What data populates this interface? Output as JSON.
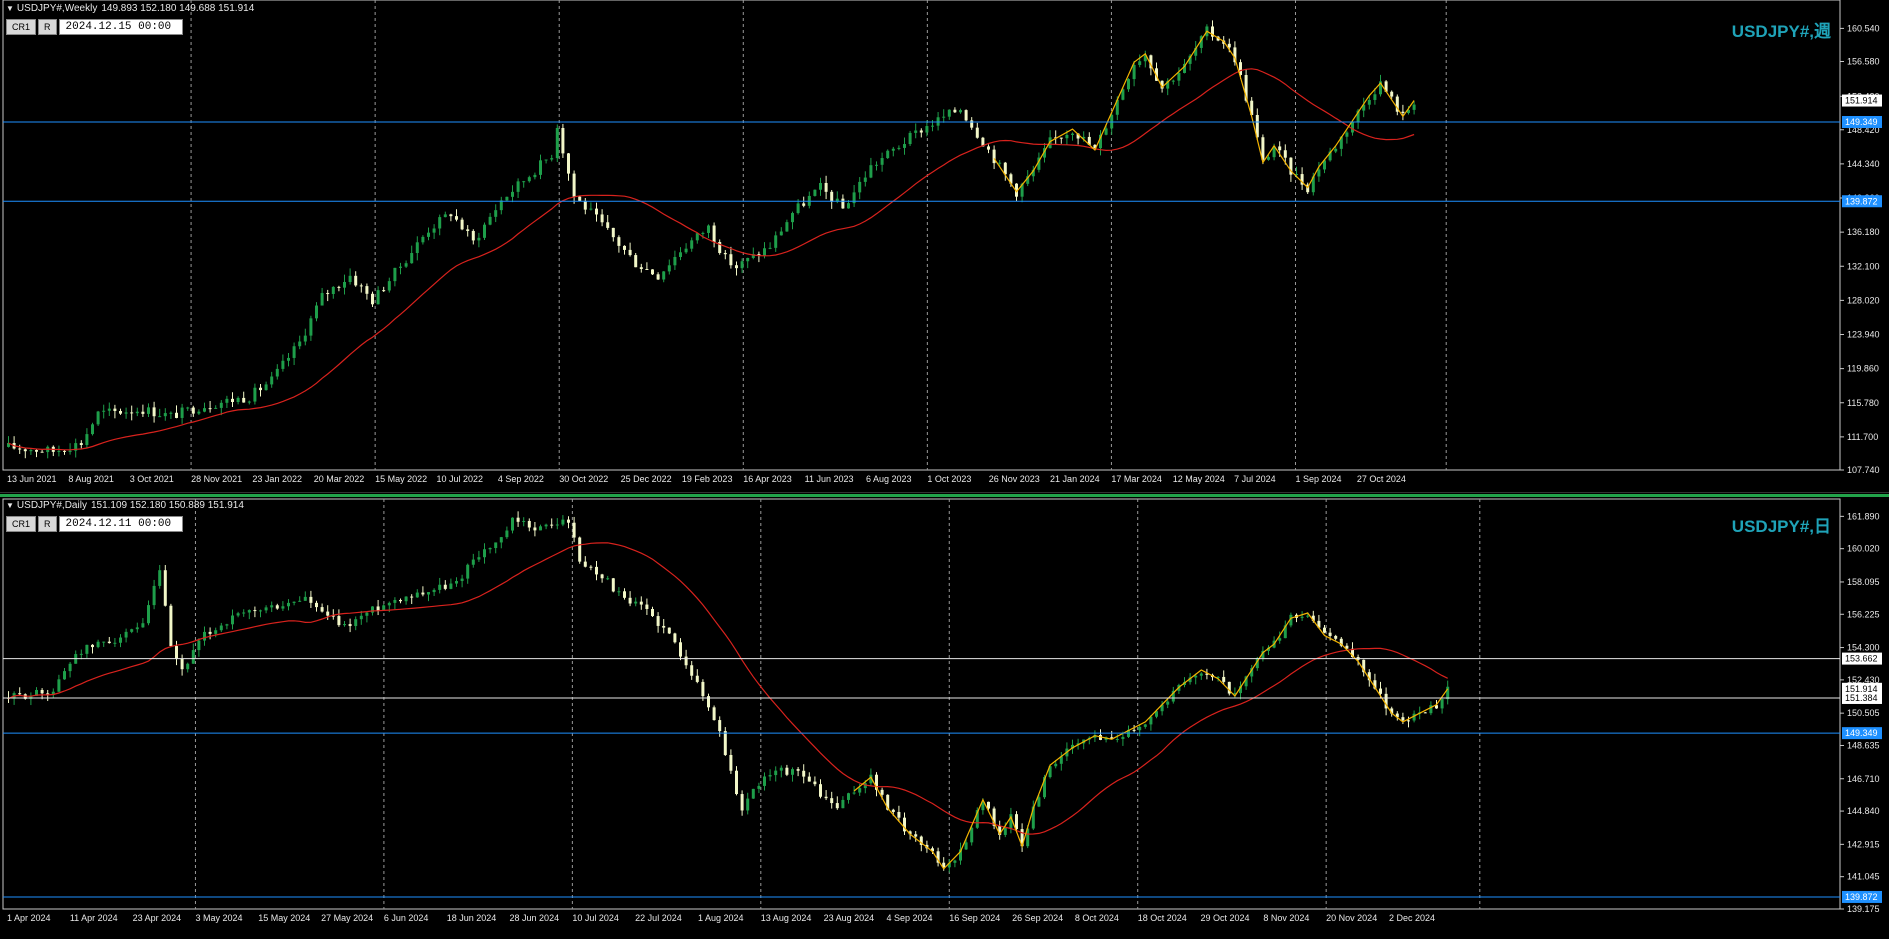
{
  "weekly": {
    "header_name": "USDJPY#,Weekly",
    "ohlc": "149.893 152.180 149.688 151.914",
    "cr_label": "CR1",
    "r_label": "R",
    "date_value": "2024.12.15 00:00",
    "symbol_label": "USDJPY#,週",
    "price_ticks": [
      "160.540",
      "156.580",
      "152.420",
      "148.420",
      "144.340",
      "140.260",
      "136.180",
      "132.100",
      "128.020",
      "123.940",
      "119.860",
      "115.780",
      "111.700",
      "107.740"
    ],
    "price_labels": [
      {
        "text": "151.914",
        "bg": "#ffffff",
        "fg": "#000000"
      },
      {
        "text": "149.349",
        "bg": "#1e90ff",
        "fg": "#ffffff"
      },
      {
        "text": "139.872",
        "bg": "#1e90ff",
        "fg": "#ffffff"
      }
    ],
    "time_labels": [
      "13 Jun 2021",
      "8 Aug 2021",
      "3 Oct 2021",
      "28 Nov 2021",
      "23 Jan 2022",
      "20 Mar 2022",
      "15 May 2022",
      "10 Jul 2022",
      "4 Sep 2022",
      "30 Oct 2022",
      "25 Dec 2022",
      "19 Feb 2023",
      "16 Apr 2023",
      "11 Jun 2023",
      "6 Aug 2023",
      "1 Oct 2023",
      "26 Nov 2023",
      "21 Jan 2024",
      "17 Mar 2024",
      "12 May 2024",
      "7 Jul 2024",
      "1 Sep 2024",
      "27 Oct 2024"
    ]
  },
  "daily": {
    "header_name": "USDJPY#,Daily",
    "ohlc": "151.109 152.180 150.889 151.914",
    "cr_label": "CR1",
    "r_label": "R",
    "date_value": "2024.12.11 00:00",
    "symbol_label": "USDJPY#,日",
    "price_ticks": [
      "161.890",
      "160.020",
      "158.095",
      "156.225",
      "154.300",
      "152.430",
      "150.505",
      "148.635",
      "146.710",
      "144.840",
      "142.915",
      "141.045",
      "139.175"
    ],
    "price_labels": [
      {
        "text": "153.662",
        "bg": "#ffffff",
        "fg": "#000000"
      },
      {
        "text": "151.914",
        "bg": "#ffffff",
        "fg": "#000000"
      },
      {
        "text": "151.384",
        "bg": "#ffffff",
        "fg": "#000000"
      },
      {
        "text": "149.349",
        "bg": "#1e90ff",
        "fg": "#ffffff"
      },
      {
        "text": "139.872",
        "bg": "#1e90ff",
        "fg": "#ffffff"
      }
    ],
    "time_labels": [
      "1 Apr 2024",
      "11 Apr 2024",
      "23 Apr 2024",
      "3 May 2024",
      "15 May 2024",
      "27 May 2024",
      "6 Jun 2024",
      "18 Jun 2024",
      "28 Jun 2024",
      "10 Jul 2024",
      "22 Jul 2024",
      "1 Aug 2024",
      "13 Aug 2024",
      "23 Aug 2024",
      "4 Sep 2024",
      "16 Sep 2024",
      "26 Sep 2024",
      "8 Oct 2024",
      "18 Oct 2024",
      "29 Oct 2024",
      "8 Nov 2024",
      "20 Nov 2024",
      "2 Dec 2024"
    ]
  },
  "colors": {
    "bull": "#1e9e4a",
    "bear": "#f2f7c8",
    "ma": "#d8221d",
    "zigzag": "#f4b400",
    "hline_blue": "#1e90ff",
    "hline_white": "#e8e8e8",
    "grid": "#9a9a9a",
    "symbol": "#1fa3b8"
  },
  "chart_data": [
    {
      "type": "candlestick",
      "title": "USDJPY#,週",
      "timeframe": "Weekly",
      "ylim": [
        107.74,
        162.5
      ],
      "anchors": [
        [
          0,
          110.5
        ],
        [
          8,
          110.0
        ],
        [
          13,
          111.0
        ],
        [
          16,
          114.5
        ],
        [
          24,
          115.0
        ],
        [
          29,
          114.2
        ],
        [
          34,
          115.3
        ],
        [
          39,
          116.0
        ],
        [
          43,
          116.5
        ],
        [
          47,
          118.5
        ],
        [
          52,
          123.0
        ],
        [
          56,
          128.5
        ],
        [
          61,
          131.0
        ],
        [
          65,
          128.0
        ],
        [
          71,
          133.0
        ],
        [
          75,
          136.5
        ],
        [
          79,
          138.5
        ],
        [
          83,
          135.0
        ],
        [
          88,
          140.0
        ],
        [
          93,
          143.0
        ],
        [
          97,
          145.5
        ],
        [
          98,
          149.0
        ],
        [
          99,
          146.0
        ],
        [
          101,
          140.5
        ],
        [
          104,
          138.5
        ],
        [
          108,
          135.5
        ],
        [
          112,
          132.5
        ],
        [
          116,
          131.0
        ],
        [
          120,
          134.0
        ],
        [
          125,
          136.8
        ],
        [
          128,
          133.0
        ],
        [
          130,
          132.0
        ],
        [
          136,
          134.5
        ],
        [
          140,
          138.5
        ],
        [
          145,
          141.5
        ],
        [
          149,
          139.0
        ],
        [
          154,
          144.0
        ],
        [
          159,
          146.5
        ],
        [
          163,
          148.5
        ],
        [
          170,
          151.0
        ],
        [
          173,
          148.0
        ],
        [
          176,
          145.0
        ],
        [
          180,
          141.0
        ],
        [
          183,
          143.5
        ],
        [
          186,
          147.0
        ],
        [
          190,
          148.5
        ],
        [
          194,
          146.0
        ],
        [
          197,
          150.5
        ],
        [
          201,
          156.5
        ],
        [
          203,
          157.5
        ],
        [
          206,
          153.5
        ],
        [
          210,
          156.0
        ],
        [
          214,
          160.2
        ],
        [
          217,
          159.0
        ],
        [
          219,
          157.0
        ],
        [
          222,
          150.0
        ],
        [
          224,
          144.5
        ],
        [
          226,
          146.5
        ],
        [
          229,
          143.5
        ],
        [
          232,
          141.5
        ],
        [
          234,
          144.0
        ],
        [
          237,
          146.5
        ],
        [
          240,
          149.5
        ],
        [
          243,
          152.5
        ],
        [
          245,
          154.0
        ],
        [
          247,
          152.0
        ],
        [
          249,
          150.0
        ],
        [
          251,
          151.914
        ]
      ],
      "moving_average": "red line",
      "horizontal_lines": [
        149.349,
        139.872
      ],
      "last_price": 151.914
    },
    {
      "type": "candlestick",
      "title": "USDJPY#,日",
      "timeframe": "Daily",
      "ylim": [
        139.175,
        162.2
      ],
      "anchors": [
        [
          0,
          151.4
        ],
        [
          8,
          151.8
        ],
        [
          12,
          154.0
        ],
        [
          16,
          154.5
        ],
        [
          21,
          155.0
        ],
        [
          24,
          155.5
        ],
        [
          27,
          158.8
        ],
        [
          29,
          154.2
        ],
        [
          31,
          153.0
        ],
        [
          35,
          155.0
        ],
        [
          40,
          156.0
        ],
        [
          45,
          156.5
        ],
        [
          50,
          156.8
        ],
        [
          53,
          157.2
        ],
        [
          55,
          156.5
        ],
        [
          60,
          155.5
        ],
        [
          65,
          156.5
        ],
        [
          70,
          157.2
        ],
        [
          75,
          157.6
        ],
        [
          80,
          158.0
        ],
        [
          83,
          159.5
        ],
        [
          88,
          160.5
        ],
        [
          90,
          161.6
        ],
        [
          95,
          161.2
        ],
        [
          100,
          161.7
        ],
        [
          102,
          159.3
        ],
        [
          106,
          158.5
        ],
        [
          110,
          157.0
        ],
        [
          114,
          156.5
        ],
        [
          118,
          155.0
        ],
        [
          121,
          153.5
        ],
        [
          124,
          151.5
        ],
        [
          127,
          149.5
        ],
        [
          129,
          147.0
        ],
        [
          131,
          145.0
        ],
        [
          134,
          146.5
        ],
        [
          138,
          147.2
        ],
        [
          142,
          147.0
        ],
        [
          145,
          145.8
        ],
        [
          148,
          145.0
        ],
        [
          151,
          146.0
        ],
        [
          154,
          146.8
        ],
        [
          157,
          145.0
        ],
        [
          161,
          143.5
        ],
        [
          165,
          142.5
        ],
        [
          167,
          141.5
        ],
        [
          170,
          142.5
        ],
        [
          172,
          144.0
        ],
        [
          174,
          145.5
        ],
        [
          177,
          143.5
        ],
        [
          179,
          144.5
        ],
        [
          181,
          142.8
        ],
        [
          183,
          145.0
        ],
        [
          186,
          147.5
        ],
        [
          190,
          148.5
        ],
        [
          194,
          149.2
        ],
        [
          197,
          149.0
        ],
        [
          200,
          149.5
        ],
        [
          203,
          150.0
        ],
        [
          206,
          151.0
        ],
        [
          209,
          152.0
        ],
        [
          213,
          153.0
        ],
        [
          216,
          152.5
        ],
        [
          219,
          151.5
        ],
        [
          221,
          152.5
        ],
        [
          224,
          154.0
        ],
        [
          226,
          154.5
        ],
        [
          229,
          156.0
        ],
        [
          232,
          156.3
        ],
        [
          235,
          155.0
        ],
        [
          238,
          154.5
        ],
        [
          241,
          153.5
        ],
        [
          244,
          152.0
        ],
        [
          247,
          150.5
        ],
        [
          249,
          150.0
        ],
        [
          252,
          150.5
        ],
        [
          255,
          151.0
        ],
        [
          257,
          151.914
        ]
      ],
      "moving_average": "red line",
      "horizontal_lines": [
        153.662,
        151.384,
        149.349,
        139.872
      ],
      "last_price": 151.914
    }
  ]
}
